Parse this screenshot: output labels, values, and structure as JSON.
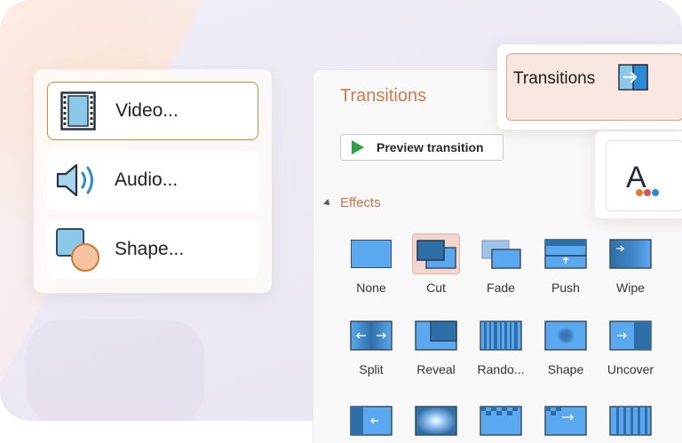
{
  "insert_menu": {
    "items": [
      {
        "label": "Video...",
        "icon": "video-film-icon",
        "selected": true
      },
      {
        "label": "Audio...",
        "icon": "speaker-icon",
        "selected": false
      },
      {
        "label": "Shape...",
        "icon": "shapes-icon",
        "selected": false
      }
    ]
  },
  "transitions_panel": {
    "title": "Transitions",
    "preview_button": "Preview transition",
    "effects_header": "Effects",
    "effects_row1": [
      "None",
      "Cut",
      "Fade",
      "Push",
      "Wipe"
    ],
    "effects_row2": [
      "Split",
      "Reveal",
      "Rando...",
      "Shape",
      "Uncover"
    ],
    "selected_effect": "Cut"
  },
  "tab_card": {
    "label": "Transitions",
    "icon": "transitions-icon"
  },
  "animations_card": {
    "icon": "animation-letter-icon",
    "glyph": "A"
  },
  "colors": {
    "accent": "#d4622e",
    "thumb_blue": "#5aa9f0",
    "selection": "#f2d6cd",
    "play_green": "#2ea043"
  }
}
